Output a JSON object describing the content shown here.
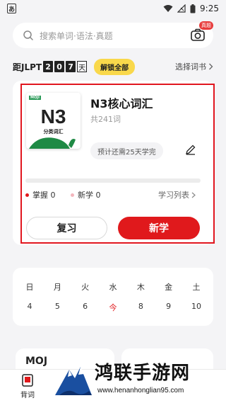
{
  "status_bar": {
    "app_badge": "あ",
    "time": "9:25"
  },
  "search": {
    "placeholder": "搜索单词·语法·真题",
    "camera_badge": "真题"
  },
  "countdown": {
    "label": "距JLPT",
    "digits": [
      "2",
      "0",
      "7"
    ],
    "day_unit": "天",
    "unlock_label": "解锁全部",
    "select_book_label": "选择词书"
  },
  "book": {
    "cover_logo": "MOJI",
    "cover_level": "N3",
    "cover_subtitle": "分类词汇",
    "title": "N3核心词汇",
    "word_count": "共241词",
    "estimate": "预计还需25天学完",
    "progress": 0,
    "mastered": "掌握 0",
    "new_words": "新学 0",
    "study_list": "学习列表",
    "review_button": "复习",
    "new_button": "新学",
    "accent_color": "#e0191c"
  },
  "calendar": {
    "weekdays": [
      "日",
      "月",
      "火",
      "水",
      "木",
      "金",
      "土"
    ],
    "dates": [
      "4",
      "5",
      "6",
      "今",
      "8",
      "9",
      "10"
    ]
  },
  "bottom_cards": {
    "left_title": "MOJ"
  },
  "tabbar": {
    "tab_label": "背词"
  },
  "watermark": {
    "text": "鸿联手游网",
    "url": "www.henanhonglian95.com"
  }
}
